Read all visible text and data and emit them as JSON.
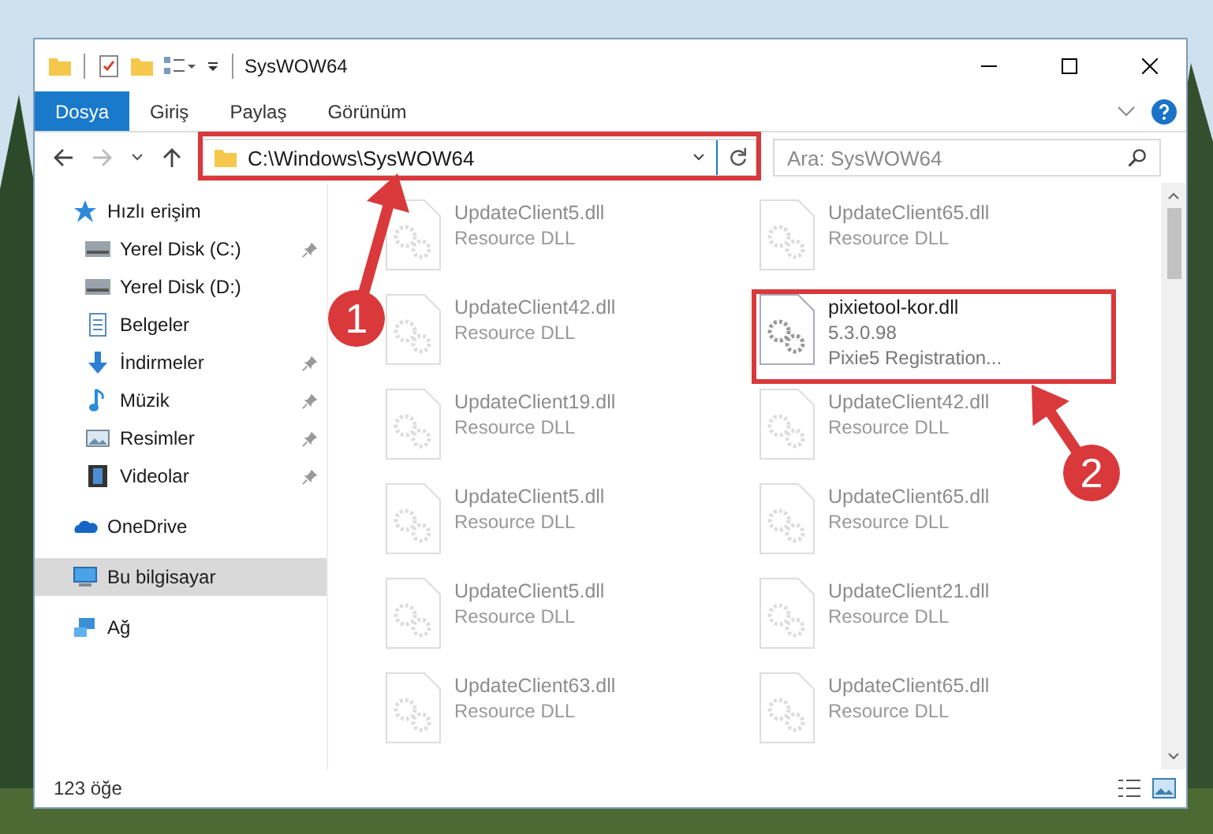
{
  "window": {
    "title": "SysWOW64"
  },
  "ribbon_tabs": [
    {
      "label": "Dosya",
      "selected": true
    },
    {
      "label": "Giriş",
      "selected": false
    },
    {
      "label": "Paylaş",
      "selected": false
    },
    {
      "label": "Görünüm",
      "selected": false
    }
  ],
  "address": {
    "path": "C:\\Windows\\SysWOW64"
  },
  "search": {
    "placeholder": "Ara: SysWOW64"
  },
  "sidebar": {
    "items": [
      {
        "label": "Hızlı erişim",
        "kind": "star",
        "selected": false,
        "children": [
          {
            "label": "Yerel Disk (C:)",
            "kind": "drive",
            "pinned": true,
            "selected": false
          },
          {
            "label": "Yerel Disk (D:)",
            "kind": "drive",
            "pinned": false,
            "selected": false
          },
          {
            "label": "Belgeler",
            "kind": "document",
            "pinned": false,
            "selected": false
          },
          {
            "label": "İndirmeler",
            "kind": "download",
            "pinned": true,
            "selected": false
          },
          {
            "label": "Müzik",
            "kind": "music",
            "pinned": true,
            "selected": false
          },
          {
            "label": "Resimler",
            "kind": "pictures",
            "pinned": true,
            "selected": false
          },
          {
            "label": "Videolar",
            "kind": "video",
            "pinned": true,
            "selected": false
          }
        ]
      },
      {
        "label": "OneDrive",
        "kind": "cloud",
        "selected": false
      },
      {
        "label": "Bu bilgisayar",
        "kind": "computer",
        "selected": true
      },
      {
        "label": "Ağ",
        "kind": "network",
        "selected": false
      }
    ]
  },
  "files": [
    {
      "name": "UpdateClient5.dll",
      "details": [
        "Resource DLL"
      ],
      "blurred": true
    },
    {
      "name": "UpdateClient65.dll",
      "details": [
        "Resource DLL"
      ],
      "blurred": true
    },
    {
      "name": "UpdateClient42.dll",
      "details": [
        "Resource DLL"
      ],
      "blurred": true
    },
    {
      "name": "pixietool-kor.dll",
      "details": [
        "5.3.0.98",
        "Pixie5 Registration..."
      ],
      "blurred": false
    },
    {
      "name": "UpdateClient19.dll",
      "details": [
        "Resource DLL"
      ],
      "blurred": true
    },
    {
      "name": "UpdateClient42.dll",
      "details": [
        "Resource DLL"
      ],
      "blurred": true
    },
    {
      "name": "UpdateClient5.dll",
      "details": [
        "Resource DLL"
      ],
      "blurred": true
    },
    {
      "name": "UpdateClient65.dll",
      "details": [
        "Resource DLL"
      ],
      "blurred": true
    },
    {
      "name": "UpdateClient5.dll",
      "details": [
        "Resource DLL"
      ],
      "blurred": true
    },
    {
      "name": "UpdateClient21.dll",
      "details": [
        "Resource DLL"
      ],
      "blurred": true
    },
    {
      "name": "UpdateClient63.dll",
      "details": [
        "Resource DLL"
      ],
      "blurred": true
    },
    {
      "name": "UpdateClient65.dll",
      "details": [
        "Resource DLL"
      ],
      "blurred": true
    }
  ],
  "status_bar": {
    "count": "123 öğe"
  },
  "annotations": [
    {
      "number": "1"
    },
    {
      "number": "2"
    }
  ]
}
